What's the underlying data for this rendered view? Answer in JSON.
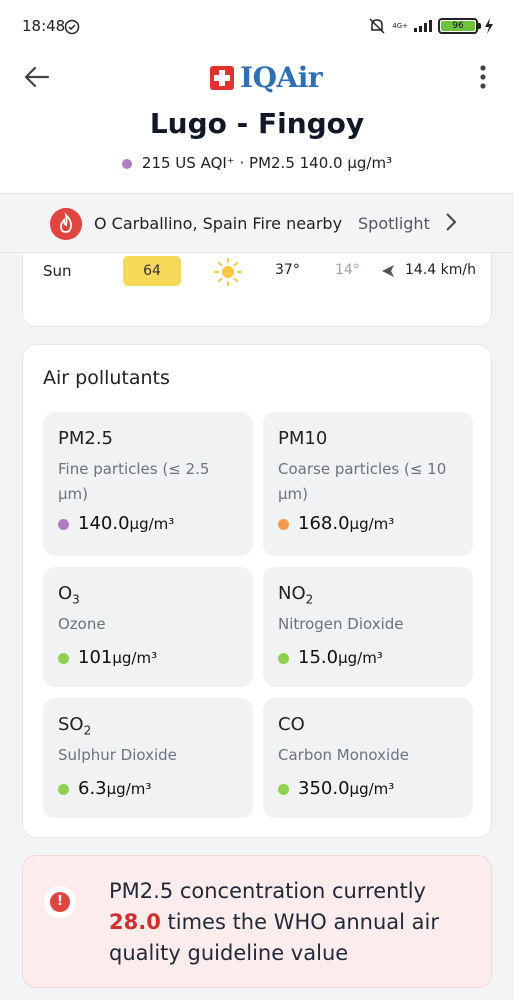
{
  "status_bar": {
    "time": "18:48",
    "network": "4G+",
    "battery": "96"
  },
  "header": {
    "brand": "IQAir",
    "city": "Lugo - Fingoy",
    "aqi_text": "215 US AQI⁺ · PM2.5 140.0 µg/m³",
    "aqi_dot_color": "#b07cc6"
  },
  "fire_banner": {
    "text": "O Carballino, Spain Fire nearby",
    "link": "Spotlight"
  },
  "forecast_row": {
    "day": "Sun",
    "aqi": "64",
    "aqi_color": "#f7d95a",
    "weather_icon": "sun-icon",
    "high": "37°",
    "low": "14°",
    "wind": "14.4 km/h"
  },
  "pollutants": {
    "title": "Air pollutants",
    "items": [
      {
        "name": "PM2.5",
        "sub": "",
        "desc": "Fine particles (≤ 2.5 µm)",
        "value": "140.0",
        "unit": "µg/m³",
        "color": "#b07cc6"
      },
      {
        "name": "PM10",
        "sub": "",
        "desc": "Coarse particles (≤ 10 µm)",
        "value": "168.0",
        "unit": "µg/m³",
        "color": "#f39a4f"
      },
      {
        "name": "O",
        "sub": "3",
        "desc": "Ozone",
        "value": "101",
        "unit": "µg/m³",
        "color": "#8fd14f"
      },
      {
        "name": "NO",
        "sub": "2",
        "desc": "Nitrogen Dioxide",
        "value": "15.0",
        "unit": "µg/m³",
        "color": "#8fd14f"
      },
      {
        "name": "SO",
        "sub": "2",
        "desc": "Sulphur Dioxide",
        "value": "6.3",
        "unit": "µg/m³",
        "color": "#8fd14f"
      },
      {
        "name": "CO",
        "sub": "",
        "desc": "Carbon Monoxide",
        "value": "350.0",
        "unit": "µg/m³",
        "color": "#8fd14f"
      }
    ]
  },
  "who_alert": {
    "before": "PM2.5 concentration currently",
    "ratio": "28.0",
    "after": "times the WHO annual air quality guideline value"
  }
}
